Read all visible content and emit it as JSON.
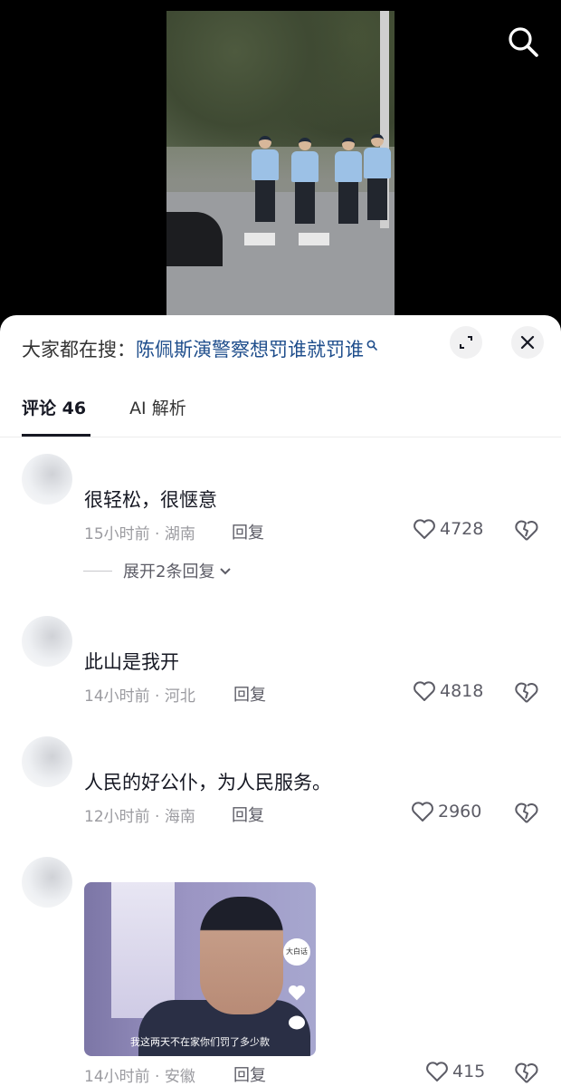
{
  "search": {
    "prefix": "大家都在搜：",
    "query": "陈佩斯演警察想罚谁就罚谁"
  },
  "tabs": [
    {
      "label": "评论 46"
    },
    {
      "label": "AI 解析"
    }
  ],
  "comments": [
    {
      "text": "很轻松，很惬意",
      "time_location": "15小时前 · 湖南",
      "reply_label": "回复",
      "likes": "4728",
      "expand_replies": "展开2条回复"
    },
    {
      "text": "此山是我开",
      "time_location": "14小时前 · 河北",
      "reply_label": "回复",
      "likes": "4818"
    },
    {
      "text": "人民的好公仆，为人民服务。",
      "time_location": "12小时前 · 海南",
      "reply_label": "回复",
      "likes": "2960"
    },
    {
      "time_location": "14小时前 · 安徽",
      "reply_label": "回复",
      "likes": "415",
      "image": {
        "subtitle": "我这两天不在家你们罚了多少款",
        "badge": "大白话"
      }
    }
  ],
  "colors": {
    "accent_link": "#1f4e8c",
    "text_primary": "#161823",
    "text_secondary": "#9b9ba0"
  }
}
